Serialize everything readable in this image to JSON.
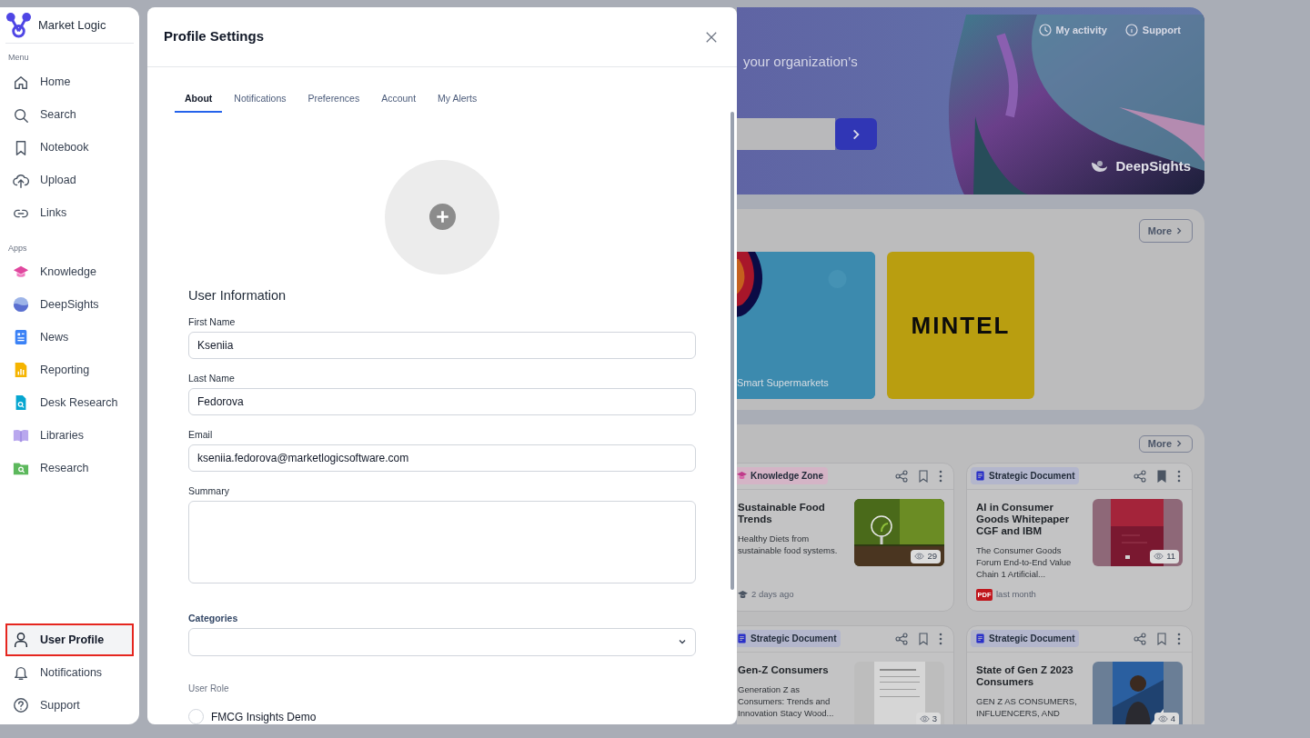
{
  "sidebar": {
    "brand": "Market Logic",
    "sections": [
      {
        "title": "Menu",
        "items": [
          {
            "label": "Home",
            "selected": false
          },
          {
            "label": "Search",
            "selected": false
          },
          {
            "label": "Notebook",
            "selected": false
          },
          {
            "label": "Upload",
            "selected": false
          },
          {
            "label": "Links",
            "selected": false
          }
        ]
      },
      {
        "title": "Apps",
        "items": [
          {
            "label": "Knowledge",
            "selected": false
          },
          {
            "label": "DeepSights",
            "selected": false
          },
          {
            "label": "News",
            "selected": false
          },
          {
            "label": "Reporting",
            "selected": false
          },
          {
            "label": "Desk Research",
            "selected": false
          },
          {
            "label": "Libraries",
            "selected": false
          },
          {
            "label": "Research",
            "selected": false
          }
        ]
      }
    ],
    "bottom_items": [
      {
        "label": "User Profile",
        "selected": true
      },
      {
        "label": "Notifications",
        "selected": false
      },
      {
        "label": "Support",
        "selected": false
      }
    ]
  },
  "modal": {
    "title": "Profile Settings",
    "tabs": [
      {
        "label": "About",
        "selected": true
      },
      {
        "label": "Notifications",
        "selected": false
      },
      {
        "label": "Preferences",
        "selected": false
      },
      {
        "label": "Account",
        "selected": false
      },
      {
        "label": "My Alerts",
        "selected": false
      }
    ],
    "section_title": "User Information",
    "fields": [
      {
        "kind": "text",
        "label": "First Name",
        "value": "Kseniia"
      },
      {
        "kind": "text",
        "label": "Last Name",
        "value": "Fedorova"
      },
      {
        "kind": "text",
        "label": "Email",
        "value": "kseniia.fedorova@marketlogicsoftware.com"
      },
      {
        "kind": "textarea",
        "label": "Summary"
      },
      {
        "kind": "select",
        "label": "Categories"
      }
    ],
    "user_role": {
      "label": "User Role",
      "options": [
        {
          "label": "FMCG Insights Demo",
          "checked": false
        }
      ]
    }
  },
  "background": {
    "hero": {
      "subtitle": "your organization’s",
      "links": [
        "My activity",
        "Support"
      ],
      "logo": "DeepSights"
    },
    "tiles_section": {
      "more": "More",
      "tiles": [
        {
          "kind": "picture",
          "caption": "Smart Supermarkets"
        },
        {
          "kind": "logo",
          "text": "MINTEL"
        }
      ]
    },
    "cards_section": {
      "more": "More",
      "cards": [
        {
          "kind": "knowledge",
          "tag": "Knowledge Zone",
          "bookmarked": false,
          "title": "Sustainable Food Trends",
          "description": "Healthy Diets from sustainable food systems.",
          "views": "29",
          "footer": {
            "kind": "course",
            "time": "2 days ago"
          }
        },
        {
          "kind": "document",
          "tag": "Strategic Document",
          "bookmarked": true,
          "title": "AI in Consumer Goods Whitepaper CGF and IBM",
          "description": "The Consumer Goods Forum End-to-End Value Chain 1 Artificial...",
          "views": "11",
          "footer": {
            "kind": "pdf",
            "badge": "PDF",
            "time": "last month"
          }
        },
        {
          "kind": "document",
          "tag": "Strategic Document",
          "bookmarked": false,
          "title": "Gen-Z Consumers",
          "description": "Generation Z as Consumers: Trends and Innovation Stacy Wood...",
          "views": "3"
        },
        {
          "kind": "document",
          "tag": "Strategic Document",
          "bookmarked": false,
          "title": "State of Gen Z 2023 Consumers",
          "description": "GEN Z AS CONSUMERS, INFLUENCERS, AND",
          "views": "4"
        }
      ]
    }
  }
}
